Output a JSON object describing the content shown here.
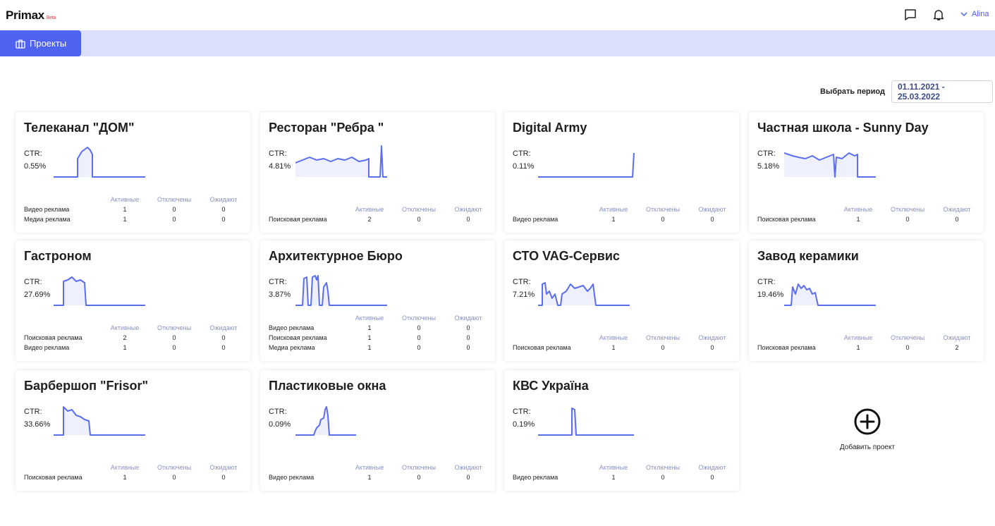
{
  "app": {
    "name": "Primax",
    "badge": "Beta"
  },
  "topbar": {
    "user_name": "Alina",
    "icons": [
      "chat-icon",
      "bell-icon",
      "chevron-down-icon"
    ]
  },
  "nav": {
    "tab_label": "Проекты",
    "tab_icon": "briefcase-icon"
  },
  "period": {
    "label": "Выбрать период",
    "value": "01.11.2021 - 25.03.2022"
  },
  "stats_headers": [
    "Активные",
    "Отключены",
    "Ожидают"
  ],
  "projects": [
    {
      "title": "Телеканал \"ДОМ\"",
      "ctr_label": "CTR:",
      "ctr": "0.55%",
      "rows": [
        {
          "name": "Видео реклама",
          "active": "1",
          "off": "0",
          "wait": "0"
        },
        {
          "name": "Медиа реклама",
          "active": "1",
          "off": "0",
          "wait": "0"
        }
      ]
    },
    {
      "title": "Ресторан \"Ребра \"",
      "ctr_label": "CTR:",
      "ctr": "4.81%",
      "rows": [
        {
          "name": "Поисковая реклама",
          "active": "2",
          "off": "0",
          "wait": "0"
        }
      ]
    },
    {
      "title": "Digital Army",
      "ctr_label": "CTR:",
      "ctr": "0.11%",
      "rows": [
        {
          "name": "Видео реклама",
          "active": "1",
          "off": "0",
          "wait": "0"
        }
      ]
    },
    {
      "title": "Частная школа - Sunny Day",
      "ctr_label": "CTR:",
      "ctr": "5.18%",
      "rows": [
        {
          "name": "Поисковая реклама",
          "active": "1",
          "off": "0",
          "wait": "0"
        }
      ]
    },
    {
      "title": "Гастроном",
      "ctr_label": "CTR:",
      "ctr": "27.69%",
      "rows": [
        {
          "name": "Поисковая реклама",
          "active": "2",
          "off": "0",
          "wait": "0"
        },
        {
          "name": "Видео реклама",
          "active": "1",
          "off": "0",
          "wait": "0"
        }
      ]
    },
    {
      "title": "Архитектурное Бюро",
      "ctr_label": "CTR:",
      "ctr": "3.87%",
      "rows": [
        {
          "name": "Видео реклама",
          "active": "1",
          "off": "0",
          "wait": "0"
        },
        {
          "name": "Поисковая реклама",
          "active": "1",
          "off": "0",
          "wait": "0"
        },
        {
          "name": "Медиа реклама",
          "active": "1",
          "off": "0",
          "wait": "0"
        }
      ]
    },
    {
      "title": "СТО VAG-Сервис",
      "ctr_label": "CTR:",
      "ctr": "7.21%",
      "rows": [
        {
          "name": "Поисковая реклама",
          "active": "1",
          "off": "0",
          "wait": "0"
        }
      ]
    },
    {
      "title": "Завод керамики",
      "ctr_label": "CTR:",
      "ctr": "19.46%",
      "rows": [
        {
          "name": "Поисковая реклама",
          "active": "1",
          "off": "0",
          "wait": "2"
        }
      ]
    },
    {
      "title": "Барбершоп \"Frisor\"",
      "ctr_label": "CTR:",
      "ctr": "33.66%",
      "rows": [
        {
          "name": "Поисковая реклама",
          "active": "1",
          "off": "0",
          "wait": "0"
        }
      ]
    },
    {
      "title": "Пластиковые окна",
      "ctr_label": "CTR:",
      "ctr": "0.09%",
      "rows": [
        {
          "name": "Видео реклама",
          "active": "1",
          "off": "0",
          "wait": "0"
        }
      ]
    },
    {
      "title": "КВС Україна",
      "ctr_label": "CTR:",
      "ctr": "0.19%",
      "rows": [
        {
          "name": "Видео реклама",
          "active": "1",
          "off": "0",
          "wait": "0"
        }
      ]
    }
  ],
  "add_project": {
    "label": "Добавить проект",
    "icon": "plus-circle-icon"
  },
  "colors": {
    "accent": "#4f63f2",
    "nav_bg": "#dcdffb",
    "spark_line": "#5b6ef0",
    "spark_fill": "#eef0fd"
  }
}
